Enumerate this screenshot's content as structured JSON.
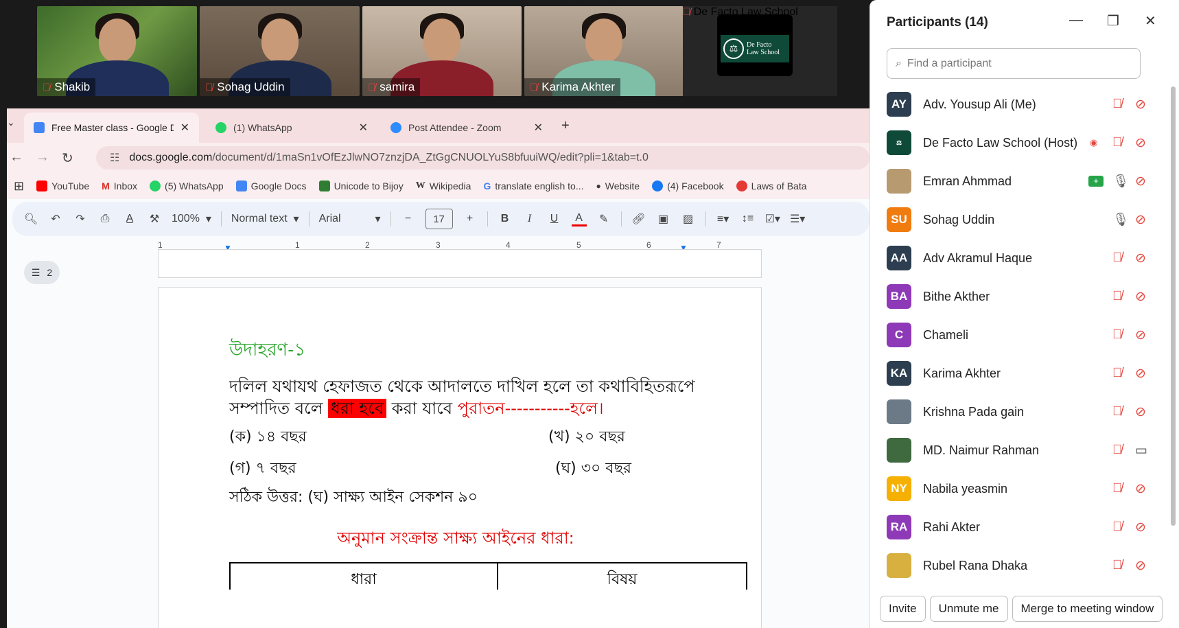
{
  "video_tiles": [
    {
      "name": "Shakib"
    },
    {
      "name": "Sohag Uddin"
    },
    {
      "name": "samira"
    },
    {
      "name": "Karima Akhter"
    },
    {
      "name": "De Facto Law School"
    }
  ],
  "logo": {
    "line1": "De Facto",
    "line2": "Law School"
  },
  "browser": {
    "tabs": [
      {
        "label": "Free Master class - Google Doc"
      },
      {
        "label": "(1) WhatsApp"
      },
      {
        "label": "Post Attendee - Zoom"
      }
    ],
    "url_host": "docs.google.com",
    "url_path": "/document/d/1maSn1vOfEzJlwNO7znzjDA_ZtGgCNUOLYuS8bfuuiWQ/edit?pli=1&tab=t.0",
    "bookmarks": [
      {
        "label": "YouTube"
      },
      {
        "label": "Inbox"
      },
      {
        "label": "(5) WhatsApp"
      },
      {
        "label": "Google Docs"
      },
      {
        "label": "Unicode to Bijoy"
      },
      {
        "label": "Wikipedia"
      },
      {
        "label": "translate english to..."
      },
      {
        "label": "Website"
      },
      {
        "label": "(4) Facebook"
      },
      {
        "label": "Laws of Bata"
      }
    ]
  },
  "toolbar": {
    "zoom": "100%",
    "style": "Normal text",
    "font": "Arial",
    "font_size": "17"
  },
  "ruler": [
    "1",
    "1",
    "2",
    "3",
    "4",
    "5",
    "6",
    "7"
  ],
  "outline_count": "2",
  "doc": {
    "example_title": "উদাহরণ-১",
    "para_line1": "দলিল যথাযথ হেফাজত থেকে আদালতে দাখিল হলে তা কথাবিহিতরূপে",
    "para_line2_a": "সম্পাদিত বলে",
    "para_line2_highlight": "ধরা হবে",
    "para_line2_b": "করা যাবে",
    "para_line2_red": "পুরাতন-----------হলে।",
    "opt_a": "(ক) ১৪ বছর",
    "opt_b": "(খ) ২০ বছর",
    "opt_c": "(গ) ৭ বছর",
    "opt_d": "(ঘ) ৩০ বছর",
    "answer": "সঠিক উত্তর: (ঘ) সাক্ষ্য আইন সেকশন ৯০",
    "section_heading": "অনুমান সংক্রান্ত সাক্ষ্য আইনের ধারা:",
    "table_col1": "ধারা",
    "table_col2": "বিষয়"
  },
  "panel": {
    "title": "Participants (14)",
    "search_placeholder": "Find a participant",
    "participants": [
      {
        "initials": "AY",
        "name": "Adv. Yousup Ali (Me)",
        "color": "#2d3e50"
      },
      {
        "initials": "",
        "name": "De Facto Law School (Host)",
        "color": "#0f4a38"
      },
      {
        "initials": "",
        "name": "Emran Ahmmad",
        "color": "#b89a70"
      },
      {
        "initials": "SU",
        "name": "Sohag Uddin",
        "color": "#f07c10"
      },
      {
        "initials": "AA",
        "name": "Adv Akramul Haque",
        "color": "#2d3e50"
      },
      {
        "initials": "BA",
        "name": "Bithe Akther",
        "color": "#8e3ab8"
      },
      {
        "initials": "C",
        "name": "Chameli",
        "color": "#8e3ab8"
      },
      {
        "initials": "KA",
        "name": "Karima Akhter",
        "color": "#2d3e50"
      },
      {
        "initials": "",
        "name": "Krishna Pada gain",
        "color": "#6c7a88"
      },
      {
        "initials": "",
        "name": "MD. Naimur Rahman",
        "color": "#3f6a40"
      },
      {
        "initials": "NY",
        "name": "Nabila yeasmin",
        "color": "#f5b000"
      },
      {
        "initials": "RA",
        "name": "Rahi Akter",
        "color": "#8e3ab8"
      },
      {
        "initials": "",
        "name": "Rubel Rana Dhaka",
        "color": "#d8b040"
      }
    ],
    "buttons": {
      "invite": "Invite",
      "unmute": "Unmute me",
      "merge": "Merge to meeting window"
    }
  }
}
